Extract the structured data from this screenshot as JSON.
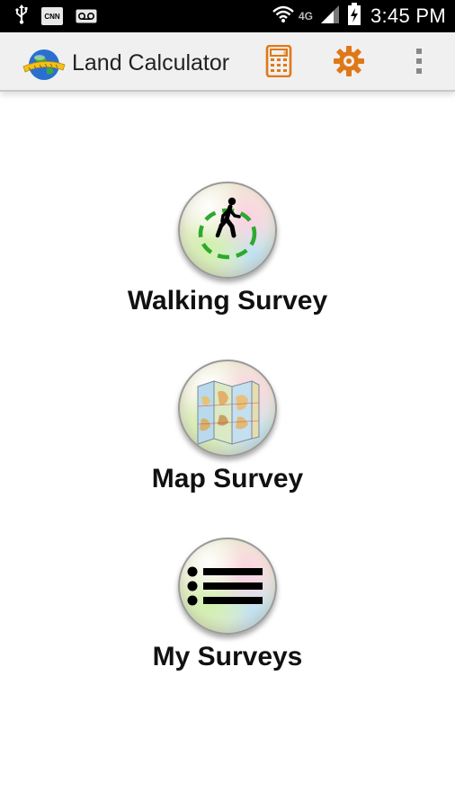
{
  "status_bar": {
    "time": "3:45 PM",
    "network": "4G",
    "icons": [
      "usb-icon",
      "cnn-icon",
      "voicemail-icon",
      "wifi-icon",
      "signal-icon",
      "battery-charging-icon"
    ],
    "cnn_label": "CNN"
  },
  "action_bar": {
    "title": "Land Calculator",
    "icons": [
      "app-globe-logo-icon",
      "calculator-icon",
      "gear-icon",
      "overflow-menu-icon"
    ],
    "accent_color": "#e07818"
  },
  "menu": {
    "items": [
      {
        "label": "Walking Survey",
        "icon": "walking-person-icon"
      },
      {
        "label": "Map Survey",
        "icon": "folded-map-icon"
      },
      {
        "label": "My Surveys",
        "icon": "list-icon"
      }
    ]
  },
  "colors": {
    "status_bar_bg": "#000000",
    "action_bar_bg": "#f0f0f0",
    "accent": "#e07818",
    "walking_ring": "#2ea82e",
    "label_text": "#111111"
  }
}
